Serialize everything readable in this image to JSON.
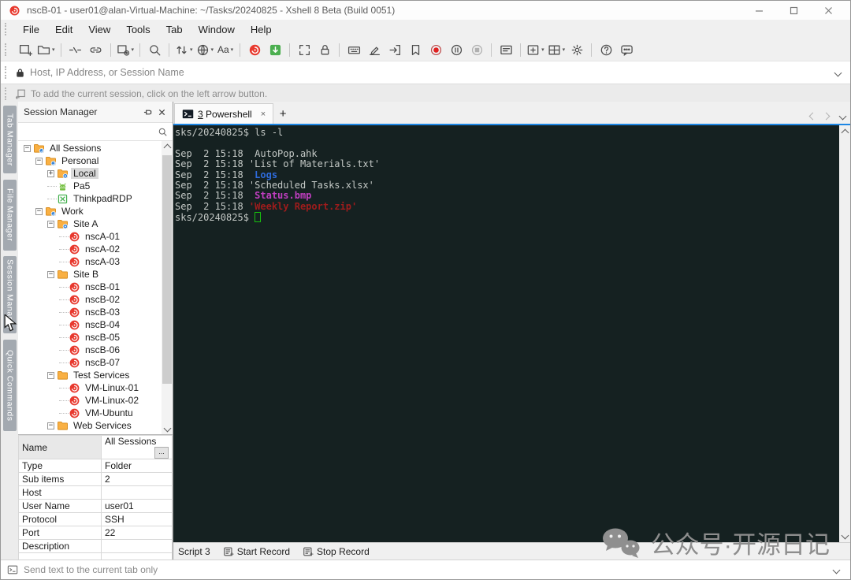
{
  "window": {
    "title": "nscB-01 - user01@alan-Virtual-Machine: ~/Tasks/20240825 - Xshell 8 Beta (Build 0051)",
    "controls": [
      "minimize",
      "maximize",
      "close"
    ]
  },
  "menu": {
    "items": [
      "File",
      "Edit",
      "View",
      "Tools",
      "Tab",
      "Window",
      "Help"
    ]
  },
  "toolbar": {
    "items": [
      {
        "icon": "new-session"
      },
      {
        "icon": "open-folder",
        "dropdown": true
      },
      {
        "sep": true
      },
      {
        "icon": "disconnect"
      },
      {
        "icon": "reconnect"
      },
      {
        "sep": true
      },
      {
        "icon": "session-properties",
        "dropdown": true
      },
      {
        "sep": true
      },
      {
        "icon": "find"
      },
      {
        "sep": true
      },
      {
        "icon": "transfer",
        "dropdown": true
      },
      {
        "icon": "web",
        "dropdown": true
      },
      {
        "icon": "encoding",
        "label": "Aa",
        "dropdown": true
      },
      {
        "sep": true
      },
      {
        "icon": "xshell"
      },
      {
        "icon": "xftp"
      },
      {
        "sep": true
      },
      {
        "icon": "fullscreen"
      },
      {
        "icon": "lock"
      },
      {
        "sep": true
      },
      {
        "icon": "keyboard"
      },
      {
        "icon": "compose"
      },
      {
        "icon": "send-text"
      },
      {
        "icon": "script"
      },
      {
        "icon": "record",
        "state": "active"
      },
      {
        "icon": "pause",
        "state": "disabled"
      },
      {
        "icon": "stop",
        "state": "disabled"
      },
      {
        "sep": true
      },
      {
        "icon": "quick-command"
      },
      {
        "sep": true
      },
      {
        "icon": "new-tab",
        "dropdown": true
      },
      {
        "icon": "layout",
        "dropdown": true
      },
      {
        "icon": "options"
      },
      {
        "sep": true
      },
      {
        "icon": "help"
      },
      {
        "icon": "feedback"
      }
    ]
  },
  "address_bar": {
    "placeholder": "Host, IP Address, or Session Name"
  },
  "hint_bar": {
    "text": "To add the current session, click on the left arrow button."
  },
  "side_tabs": {
    "items": [
      "Tab Manager",
      "File Manager",
      "Session Manager",
      "Quick Commands"
    ]
  },
  "session_manager": {
    "title": "Session Manager",
    "tree": {
      "items": [
        {
          "label": "All Sessions",
          "level": 0,
          "icon": "folder-badge",
          "expander": "minus"
        },
        {
          "label": "Personal",
          "level": 1,
          "icon": "folder-badge",
          "expander": "minus"
        },
        {
          "label": "Local",
          "level": 2,
          "icon": "folder-gear",
          "expander": "plus",
          "selected": true
        },
        {
          "label": "Pa5",
          "level": 2,
          "icon": "android"
        },
        {
          "label": "ThinkpadRDP",
          "level": 2,
          "icon": "xmanager"
        },
        {
          "label": "Work",
          "level": 1,
          "icon": "folder-badge",
          "expander": "minus"
        },
        {
          "label": "Site A",
          "level": 2,
          "icon": "folder-gear",
          "expander": "minus"
        },
        {
          "label": "nscA-01",
          "level": 3,
          "icon": "xshell"
        },
        {
          "label": "nscA-02",
          "level": 3,
          "icon": "xshell"
        },
        {
          "label": "nscA-03",
          "level": 3,
          "icon": "xshell"
        },
        {
          "label": "Site B",
          "level": 2,
          "icon": "folder",
          "expander": "minus"
        },
        {
          "label": "nscB-01",
          "level": 3,
          "icon": "xshell"
        },
        {
          "label": "nscB-02",
          "level": 3,
          "icon": "xshell"
        },
        {
          "label": "nscB-03",
          "level": 3,
          "icon": "xshell"
        },
        {
          "label": "nscB-04",
          "level": 3,
          "icon": "xshell"
        },
        {
          "label": "nscB-05",
          "level": 3,
          "icon": "xshell"
        },
        {
          "label": "nscB-06",
          "level": 3,
          "icon": "xshell"
        },
        {
          "label": "nscB-07",
          "level": 3,
          "icon": "xshell"
        },
        {
          "label": "Test Services",
          "level": 2,
          "icon": "folder",
          "expander": "minus"
        },
        {
          "label": "VM-Linux-01",
          "level": 3,
          "icon": "xshell"
        },
        {
          "label": "VM-Linux-02",
          "level": 3,
          "icon": "xshell"
        },
        {
          "label": "VM-Ubuntu",
          "level": 3,
          "icon": "xshell"
        },
        {
          "label": "Web Services",
          "level": 2,
          "icon": "folder",
          "expander": "minus"
        }
      ]
    },
    "properties": {
      "rows": [
        {
          "label": "Name",
          "value": "All Sessions",
          "button": "...",
          "highlight": true
        },
        {
          "label": "Type",
          "value": "Folder"
        },
        {
          "label": "Sub items",
          "value": "2"
        },
        {
          "label": "Host",
          "value": ""
        },
        {
          "label": "User Name",
          "value": "user01"
        },
        {
          "label": "Protocol",
          "value": "SSH"
        },
        {
          "label": "Port",
          "value": "22"
        },
        {
          "label": "Description",
          "value": ""
        },
        {
          "label": "",
          "value": ""
        }
      ]
    }
  },
  "terminal": {
    "tab": {
      "index": "3",
      "label": "Powershell",
      "close": "×",
      "new_tab": "+"
    },
    "colors": {
      "background": "#152121",
      "text": "#c4c9c6",
      "blue": "#2e6bdb",
      "magenta": "#c03ec0",
      "darkred": "#9e1c1c",
      "cursor": "#17c00e",
      "top_border": "#1d86e4"
    },
    "lines": [
      {
        "segs": [
          {
            "t": "sks/20240825$ ls -l"
          }
        ]
      },
      {
        "segs": []
      },
      {
        "segs": [
          {
            "t": "Sep  2 15:18  AutoPop.ahk"
          }
        ]
      },
      {
        "segs": [
          {
            "t": "Sep  2 15:18 'List of Materials.txt'"
          }
        ]
      },
      {
        "segs": [
          {
            "t": "Sep  2 15:18  "
          },
          {
            "t": "Logs",
            "c": "blue",
            "b": true
          }
        ]
      },
      {
        "segs": [
          {
            "t": "Sep  2 15:18 'Scheduled Tasks.xlsx'"
          }
        ]
      },
      {
        "segs": [
          {
            "t": "Sep  2 15:18  "
          },
          {
            "t": "Status.bmp",
            "c": "magenta",
            "b": true
          }
        ]
      },
      {
        "segs": [
          {
            "t": "Sep  2 15:18 "
          },
          {
            "t": "'Weekly Report.zip'",
            "c": "darkred",
            "b": true
          }
        ]
      },
      {
        "segs": [
          {
            "t": "sks/20240825$ "
          },
          {
            "cursor": true
          }
        ]
      }
    ]
  },
  "bottom_bar": {
    "buttons": [
      {
        "label": "Script 3",
        "icon": null
      },
      {
        "label": "Start Record",
        "icon": "script-record"
      },
      {
        "label": "Stop Record",
        "icon": "script-record"
      }
    ]
  },
  "status_bar": {
    "text": "Send text to the current tab only"
  },
  "watermark": {
    "text": "公众号·开源日记"
  }
}
